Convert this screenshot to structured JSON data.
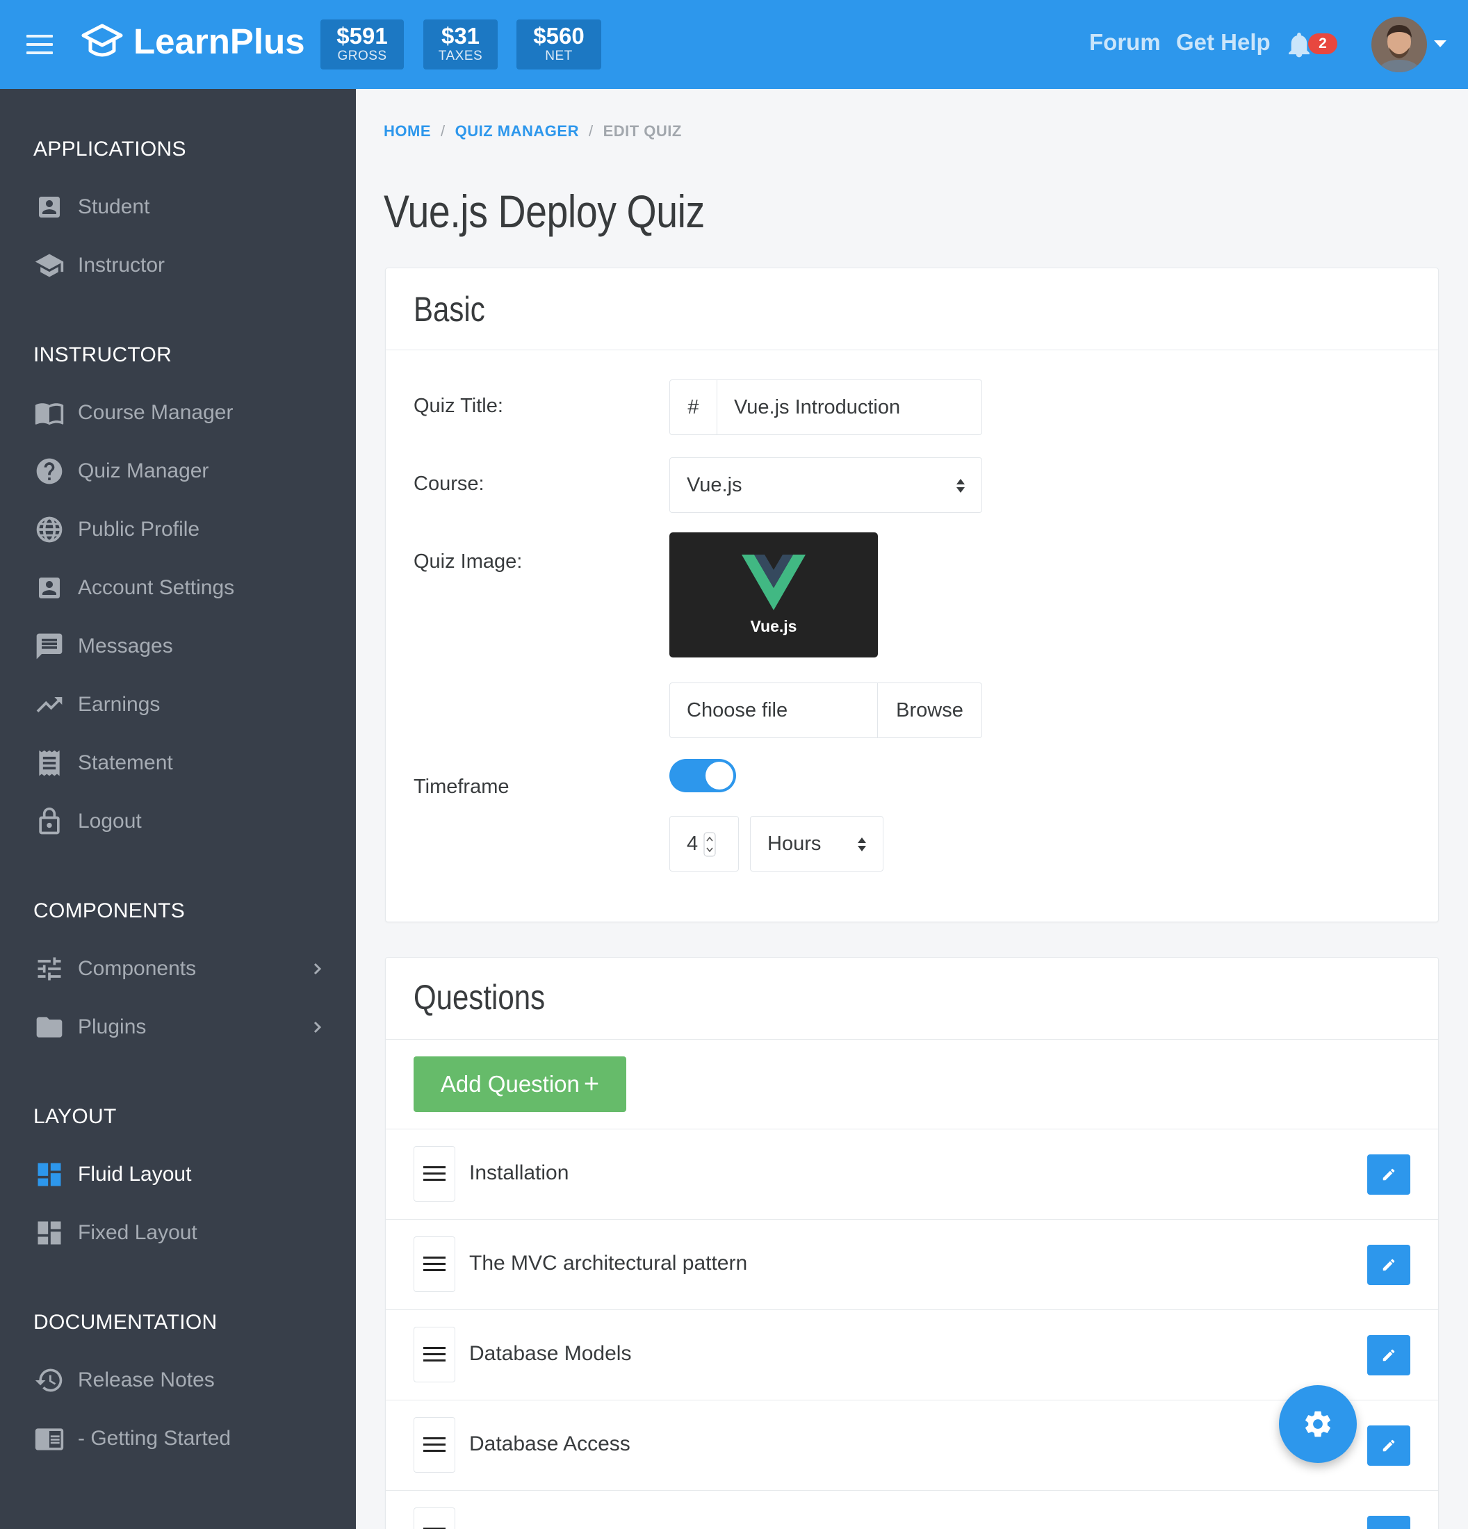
{
  "app": {
    "name": "LearnPlus",
    "stats": [
      {
        "value": "$591",
        "label": "GROSS"
      },
      {
        "value": "$31",
        "label": "TAXES"
      },
      {
        "value": "$560",
        "label": "NET"
      }
    ],
    "links": {
      "forum": "Forum",
      "help": "Get Help"
    },
    "notifications": "2"
  },
  "sidebar": {
    "sections": {
      "applications": "APPLICATIONS",
      "instructor": "INSTRUCTOR",
      "components": "COMPONENTS",
      "layout": "LAYOUT",
      "documentation": "DOCUMENTATION"
    },
    "applications": [
      {
        "label": "Student",
        "icon": "account-box-icon"
      },
      {
        "label": "Instructor",
        "icon": "school-icon"
      }
    ],
    "instructor": [
      {
        "label": "Course Manager",
        "icon": "book-icon"
      },
      {
        "label": "Quiz Manager",
        "icon": "help-circle-icon"
      },
      {
        "label": "Public Profile",
        "icon": "globe-icon"
      },
      {
        "label": "Account Settings",
        "icon": "account-box-icon"
      },
      {
        "label": "Messages",
        "icon": "message-icon"
      },
      {
        "label": "Earnings",
        "icon": "trending-up-icon"
      },
      {
        "label": "Statement",
        "icon": "receipt-icon"
      },
      {
        "label": "Logout",
        "icon": "lock-icon"
      }
    ],
    "components": [
      {
        "label": "Components",
        "icon": "tune-icon"
      },
      {
        "label": "Plugins",
        "icon": "folder-icon"
      }
    ],
    "layout": [
      {
        "label": "Fluid Layout",
        "icon": "dashboard-icon",
        "active": true
      },
      {
        "label": "Fixed Layout",
        "icon": "dashboard-icon"
      }
    ],
    "documentation": [
      {
        "label": "Release Notes",
        "icon": "history-icon"
      },
      {
        "label": "- Getting Started",
        "icon": "chrome-reader-icon"
      }
    ]
  },
  "breadcrumb": {
    "home": "HOME",
    "manager": "QUIZ MANAGER",
    "current": "EDIT QUIZ"
  },
  "page_title": "Vue.js Deploy Quiz",
  "basic": {
    "title": "Basic",
    "quiz_title_label": "Quiz Title:",
    "quiz_title_prefix": "#",
    "quiz_title_value": "Vue.js Introduction",
    "course_label": "Course:",
    "course_value": "Vue.js",
    "image_label": "Quiz Image:",
    "image_caption": "Vue.js",
    "file_placeholder": "Choose file",
    "browse": "Browse",
    "timeframe_label": "Timeframe",
    "timeframe_enabled": true,
    "timeframe_amount": "4",
    "timeframe_unit": "Hours"
  },
  "questions": {
    "title": "Questions",
    "add_button": "Add Question",
    "add_icon": "+",
    "items": [
      "Installation",
      "The MVC architectural pattern",
      "Database Models",
      "Database Access"
    ]
  },
  "colors": {
    "primary": "#2d97ec",
    "sidebar": "#383f4a",
    "success": "#66bb6a",
    "danger": "#e8473f",
    "vue_green": "#41b883",
    "vue_dark": "#35495e"
  }
}
